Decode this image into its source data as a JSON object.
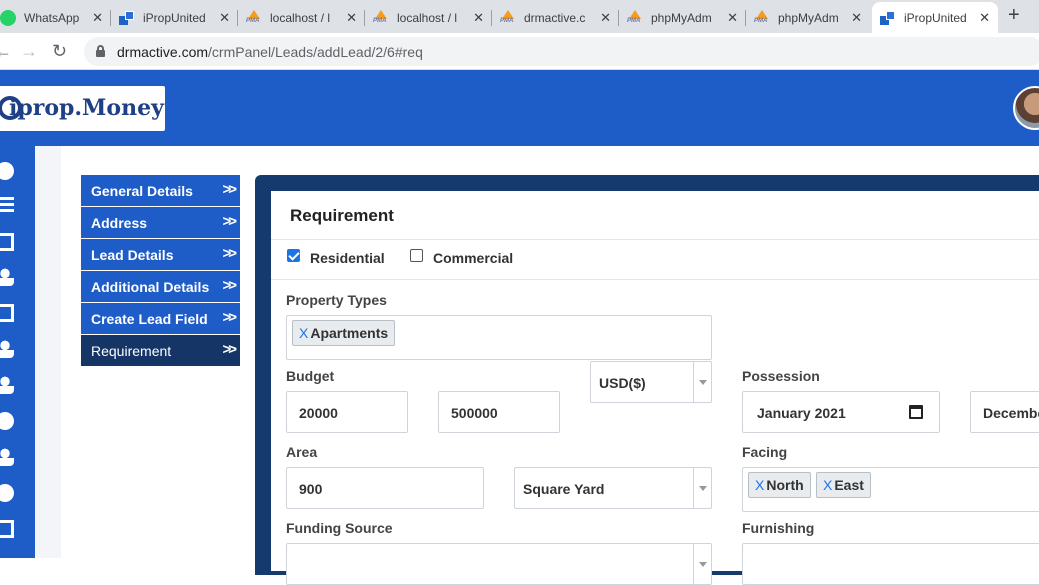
{
  "browser": {
    "tabs": [
      {
        "label": "WhatsApp",
        "icon": "whatsapp-icon"
      },
      {
        "label": "iPropUnited",
        "icon": "iprop-icon"
      },
      {
        "label": "localhost / l",
        "icon": "phpmyadmin-icon"
      },
      {
        "label": "localhost / l",
        "icon": "phpmyadmin-icon"
      },
      {
        "label": "drmactive.c",
        "icon": "phpmyadmin-icon"
      },
      {
        "label": "phpMyAdm",
        "icon": "phpmyadmin-icon"
      },
      {
        "label": "phpMyAdm",
        "icon": "phpmyadmin-icon"
      },
      {
        "label": "iPropUnited",
        "icon": "iprop-icon",
        "active": true
      }
    ],
    "url_domain": "drmactive.com",
    "url_path": "/crmPanel/Leads/addLead/2/6#req"
  },
  "header": {
    "logo_text": "iprop.Money"
  },
  "steps": [
    {
      "label": "General Details"
    },
    {
      "label": "Address"
    },
    {
      "label": "Lead Details"
    },
    {
      "label": "Additional Details"
    },
    {
      "label": "Create Lead Field"
    },
    {
      "label": "Requirement",
      "active": true
    }
  ],
  "form": {
    "title": "Requirement",
    "residential_label": "Residential",
    "residential_checked": true,
    "commercial_label": "Commercial",
    "commercial_checked": false,
    "property_types_label": "Property Types",
    "property_types": [
      "Apartments"
    ],
    "budget_label": "Budget",
    "budget_min": "20000",
    "budget_max": "500000",
    "currency": "USD($)",
    "possession_label": "Possession",
    "possession_from": "January 2021",
    "possession_to": "Decembe",
    "area_label": "Area",
    "area_value": "900",
    "area_unit": "Square Yard",
    "facing_label": "Facing",
    "facing": [
      "North",
      "East"
    ],
    "funding_source_label": "Funding Source",
    "furnishing_label": "Furnishing",
    "tag_remove_glyph": "X"
  }
}
